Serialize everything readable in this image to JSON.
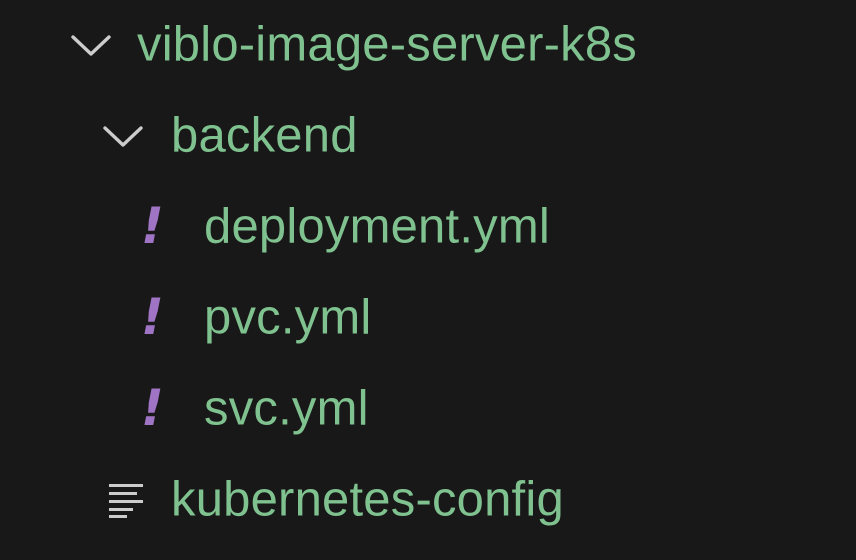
{
  "explorer": {
    "root": {
      "label": "viblo-image-server-k8s",
      "expanded": true
    },
    "items": [
      {
        "label": "backend",
        "kind": "folder",
        "expanded": true
      },
      {
        "label": "deployment.yml",
        "kind": "yaml-file"
      },
      {
        "label": "pvc.yml",
        "kind": "yaml-file"
      },
      {
        "label": "svc.yml",
        "kind": "yaml-file"
      },
      {
        "label": "kubernetes-config",
        "kind": "text-file"
      }
    ]
  },
  "colors": {
    "background": "#181818",
    "label": "#7fc28f",
    "chevron": "#cccccc",
    "yaml_icon": "#a074c4",
    "text_file_icon": "#cccccc"
  },
  "glyphs": {
    "yaml_icon": "!"
  }
}
